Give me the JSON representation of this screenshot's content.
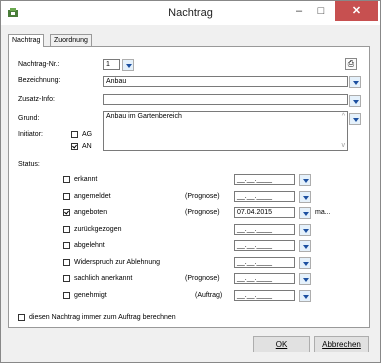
{
  "window": {
    "title": "Nachtrag",
    "minimize": "–",
    "maximize": "□",
    "close": "✕"
  },
  "tabs": [
    "Nachtrag",
    "Zuordnung"
  ],
  "form": {
    "nachtrag_nr_label": "Nachtrag-Nr.:",
    "nachtrag_nr_value": "1",
    "bezeichnung_label": "Bezeichnung:",
    "bezeichnung_value": "Anbau",
    "zusatz_label": "Zusatz-Info:",
    "zusatz_value": "",
    "grund_label": "Grund:",
    "grund_value": "Anbau im Gartenbereich",
    "initiator_label": "Initiator:",
    "ag_label": "AG",
    "an_label": "AN",
    "status_label": "Status:"
  },
  "status_rows": [
    {
      "label": "erkannt",
      "checked": false,
      "note": "",
      "date": "__.__.____"
    },
    {
      "label": "angemeldet",
      "checked": false,
      "note": "(Prognose)",
      "date": "__.__.____"
    },
    {
      "label": "angeboten",
      "checked": true,
      "note": "(Prognose)",
      "date": "07.04.2015",
      "extra": "ma..."
    },
    {
      "label": "zurückgezogen",
      "checked": false,
      "note": "",
      "date": "__.__.____"
    },
    {
      "label": "abgelehnt",
      "checked": false,
      "note": "",
      "date": "__.__.____"
    },
    {
      "label": "Widerspruch zur Ablehnung",
      "checked": false,
      "note": "",
      "date": "__.__.____"
    },
    {
      "label": "sachlich anerkannt",
      "checked": false,
      "note": "(Prognose)",
      "date": "__.__.____"
    },
    {
      "label": "genehmigt",
      "checked": false,
      "note": "(Auftrag)",
      "date": "__.__.____"
    }
  ],
  "always_calc_label": "diesen Nachtrag immer zum Auftrag berechnen",
  "buttons": {
    "ok": "OK",
    "cancel": "Abbrechen"
  }
}
